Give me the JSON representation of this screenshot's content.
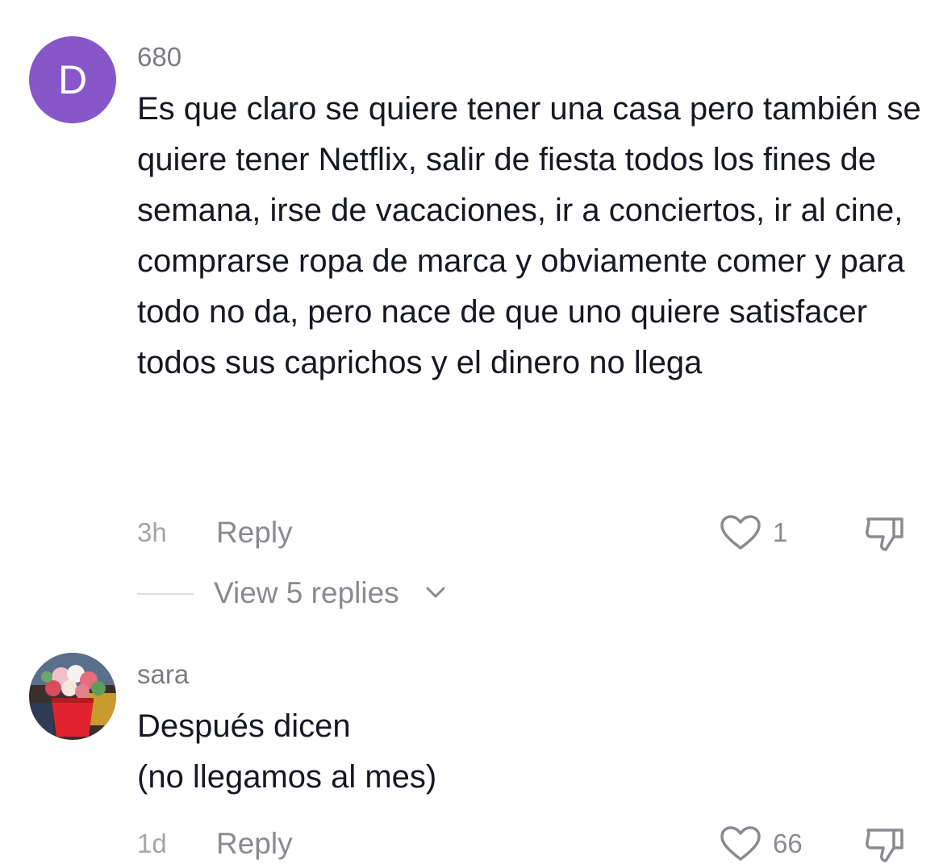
{
  "comments": [
    {
      "avatar_letter": "D",
      "avatar_color": "#8757c9",
      "username": "680",
      "text": "Es que claro se quiere tener una casa pero también se quiere tener Netflix, salir de fiesta todos los fines de semana, irse de vacaciones, ir a conciertos, ir al cine, comprarse ropa de marca y obviamente comer y para todo no da, pero nace de que uno quiere satisfacer todos sus caprichos y el dinero no llega",
      "time": "3h",
      "reply_label": "Reply",
      "like_count": "1",
      "view_replies_label": "View 5 replies"
    },
    {
      "avatar_image": "photo of flower bouquet in a red pot",
      "username": "sara",
      "text_line1": "Después dicen",
      "text_line2": "(no llegamos al mes)",
      "time": "1d",
      "reply_label": "Reply",
      "like_count": "66"
    }
  ],
  "icons": {
    "like": "heart-outline-icon",
    "dislike": "thumbs-down-outline-icon",
    "expand": "chevron-down-icon"
  }
}
